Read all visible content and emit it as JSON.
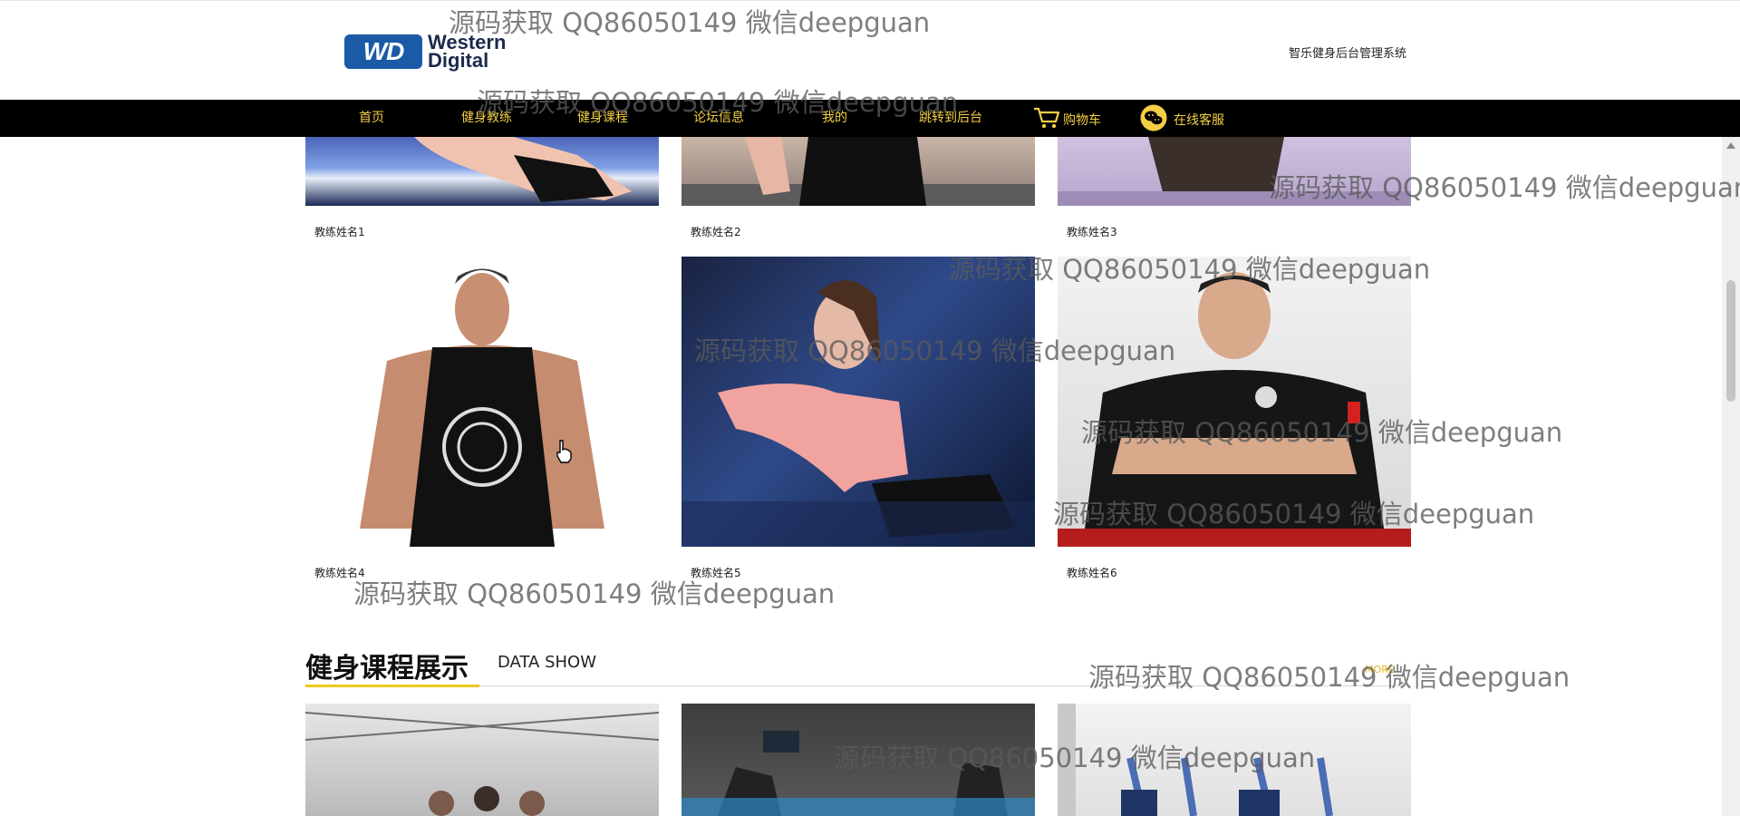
{
  "header": {
    "logo": {
      "badge": "WD",
      "line1": "Western",
      "line2": "Digital"
    },
    "system_title": "智乐健身后台管理系统"
  },
  "nav": {
    "items": [
      {
        "label": "首页"
      },
      {
        "label": "健身教练"
      },
      {
        "label": "健身课程"
      },
      {
        "label": "论坛信息"
      },
      {
        "label": "我的"
      },
      {
        "label": "跳转到后台"
      },
      {
        "label": "购物车",
        "icon": "cart-icon"
      },
      {
        "label": "在线客服",
        "icon": "wechat-icon"
      }
    ]
  },
  "coaches": [
    {
      "name": "教练姓名1"
    },
    {
      "name": "教练姓名2"
    },
    {
      "name": "教练姓名3"
    },
    {
      "name": "教练姓名4"
    },
    {
      "name": "教练姓名5"
    },
    {
      "name": "教练姓名6"
    }
  ],
  "courses_section": {
    "title": "健身课程展示",
    "subtitle": "DATA SHOW",
    "more": "MORE"
  },
  "watermark": "源码获取 QQ86050149 微信deepguan",
  "colors": {
    "nav_bg": "#000000",
    "nav_text": "#f4cf45",
    "accent": "#f2c71a",
    "logo_blue": "#1a5aa6"
  }
}
